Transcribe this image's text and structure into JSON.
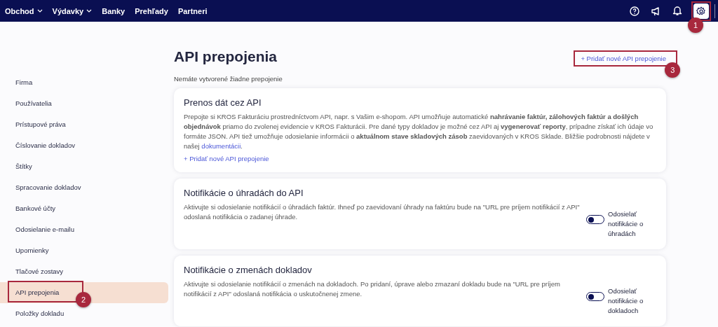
{
  "topbar": {
    "nav": [
      {
        "label": "Obchod",
        "dropdown": true
      },
      {
        "label": "Výdavky",
        "dropdown": true
      },
      {
        "label": "Banky",
        "dropdown": false
      },
      {
        "label": "Prehľady",
        "dropdown": false
      },
      {
        "label": "Partneri",
        "dropdown": false
      }
    ],
    "settings": {
      "selected": true,
      "callout": "1"
    }
  },
  "sidebar": {
    "items": [
      {
        "label": "Firma",
        "selected": false
      },
      {
        "label": "Používatelia",
        "selected": false
      },
      {
        "label": "Prístupové práva",
        "selected": false
      },
      {
        "label": "Číslovanie dokladov",
        "selected": false
      },
      {
        "label": "Štítky",
        "selected": false
      },
      {
        "label": "Spracovanie dokladov",
        "selected": false
      },
      {
        "label": "Bankové účty",
        "selected": false
      },
      {
        "label": "Odosielanie e-mailu",
        "selected": false
      },
      {
        "label": "Upomienky",
        "selected": false
      },
      {
        "label": "Tlačové zostavy",
        "selected": false
      },
      {
        "label": "API prepojenia",
        "selected": true,
        "callout": "2"
      },
      {
        "label": "Položky dokladu",
        "selected": false
      }
    ]
  },
  "page": {
    "title": "API prepojenia",
    "subtitle": "Nemáte vytvorené žiadne prepojenie",
    "add_button": {
      "label": "+ Pridať nové API prepojenie",
      "callout": "3"
    },
    "cards": [
      {
        "title": "Prenos dát cez API",
        "description": "Prepojte si KROS Fakturáciu prostredníctvom API, napr. s Vašim e-shopom. API umožňuje automatické **nahrávanie faktúr, zálohových faktúr a došlých objednávok** priamo do zvolenej evidencie v KROS Fakturácii. Pre dané typy dokladov je možné cez API aj **vygenerovať reporty**, prípadne získať ich údaje vo formáte JSON. API tiež umožňuje odosielanie informácii o **aktuálnom stave skladových zásob** zaevidovaných v KROS Sklade. Bližšie podrobnosti nájdete v našej ",
        "link": "dokumentácii",
        "description_end": ".",
        "add_link": "+ Pridať nové API prepojenie"
      },
      {
        "title": "Notifikácie o úhradách do API",
        "description": "Aktivujte si odosielanie notifikácií o úhradách faktúr. Ihneď po zaevidovaní úhrady na faktúru bude na \"URL pre príjem notifikácií z API\" odoslaná notifikácia o zadanej úhrade.",
        "toggle": {
          "label": "Odosielať notifikácie o úhradách",
          "on": false
        }
      },
      {
        "title": "Notifikácie o zmenách dokladov",
        "description": "Aktivujte si odosielanie notifikácií o zmenách na dokladoch. Po pridaní, úprave alebo zmazaní dokladu bude na \"URL pre príjem notifikácií z API\" odoslaná notifikácia o uskutočnenej zmene.",
        "toggle": {
          "label": "Odosielať notifikácie o dokladoch",
          "on": false
        }
      }
    ]
  }
}
